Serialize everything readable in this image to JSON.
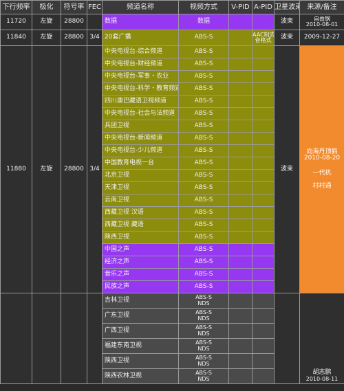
{
  "headers": {
    "freq": "下行频率",
    "pol": "极化",
    "symbol": "符号率",
    "fec": "FEC",
    "channel": "频道名称",
    "video": "视频方式",
    "vpid": "V-PID",
    "apid": "A-PID",
    "beam": "卫星波束",
    "source": "来源/备注"
  },
  "tp1": {
    "freq": "11720",
    "pol": "左旋",
    "symbol": "28800",
    "fec": "",
    "channel": "数据",
    "video": "数据",
    "vpid": "",
    "apid": "",
    "beam": "波束",
    "source_name": "自由钢",
    "source_date": "2010-08-01"
  },
  "tp2": {
    "freq": "11840",
    "pol": "左旋",
    "symbol": "28800",
    "fec": "3/4",
    "channel": "20套广播",
    "video": "ABS-S",
    "vpid": "",
    "apid_line1": "AAC制式伴",
    "apid_line2": "音格式",
    "beam": "波束",
    "source": "2009-12-27"
  },
  "tp3": {
    "freq": "11880",
    "pol": "左旋",
    "symbol": "28800",
    "fec": "3/4",
    "beam": "波束",
    "note": {
      "line1": "向海丹顶鹤",
      "line2": "2010-08-20",
      "line3": "一代机",
      "line4": "村村通"
    },
    "tv": [
      {
        "name": "中央电视台-综合频道",
        "video": "ABS-S"
      },
      {
        "name": "中央电视台-财经频道",
        "video": "ABS-S"
      },
      {
        "name": "中央电视台-军事・农业",
        "video": "ABS-S"
      },
      {
        "name": "中央电视台-科学・教育频道",
        "video": "ABS-S"
      },
      {
        "name": "四川康巴藏语卫视频道",
        "video": "ABS-S"
      },
      {
        "name": "中央电视台-社会与法频道",
        "video": "ABS-S"
      },
      {
        "name": "兵团卫视",
        "video": "ABS-S"
      },
      {
        "name": "中央电视台-新闻频道",
        "video": "ABS-S"
      },
      {
        "name": "中央电视台-少儿频道",
        "video": "ABS-S"
      },
      {
        "name": "中国教育电视一台",
        "video": "ABS-S"
      },
      {
        "name": "北京卫视",
        "video": "ABS-S"
      },
      {
        "name": "天津卫视",
        "video": "ABS-S"
      },
      {
        "name": "云南卫视",
        "video": "ABS-S"
      },
      {
        "name": "西藏卫视 汉语",
        "video": "ABS-S"
      },
      {
        "name": "西藏卫视 藏语",
        "video": "ABS-S"
      },
      {
        "name": "陕西卫视",
        "video": "ABS-S"
      }
    ],
    "radio": [
      {
        "name": "中国之声",
        "video": "ABS-S"
      },
      {
        "name": "经济之声",
        "video": "ABS-S"
      },
      {
        "name": "音乐之声",
        "video": "ABS-S"
      },
      {
        "name": "民族之声",
        "video": "ABS-S"
      }
    ]
  },
  "tp4": {
    "source_name": "胡志鹏",
    "source_date": "2010-08-11",
    "rows": [
      {
        "name": "吉林卫视",
        "video": "ABS-S",
        "enc": "NDS"
      },
      {
        "name": "广东卫视",
        "video": "ABS-S",
        "enc": "NDS"
      },
      {
        "name": "广西卫视",
        "video": "ABS-S",
        "enc": "NDS"
      },
      {
        "name": "福建东南卫视",
        "video": "ABS-S",
        "enc": "NDS"
      },
      {
        "name": "陕西卫视",
        "video": "ABS-S",
        "enc": "NDS"
      },
      {
        "name": "陕西农林卫视",
        "video": "ABS-S",
        "enc": "NDS"
      }
    ]
  },
  "colors": {
    "olive": "#8c8c0d",
    "purple": "#9638f2",
    "orange": "#f28a2e",
    "dark": "#2f2f2f",
    "gray": "#4a4a4a"
  }
}
